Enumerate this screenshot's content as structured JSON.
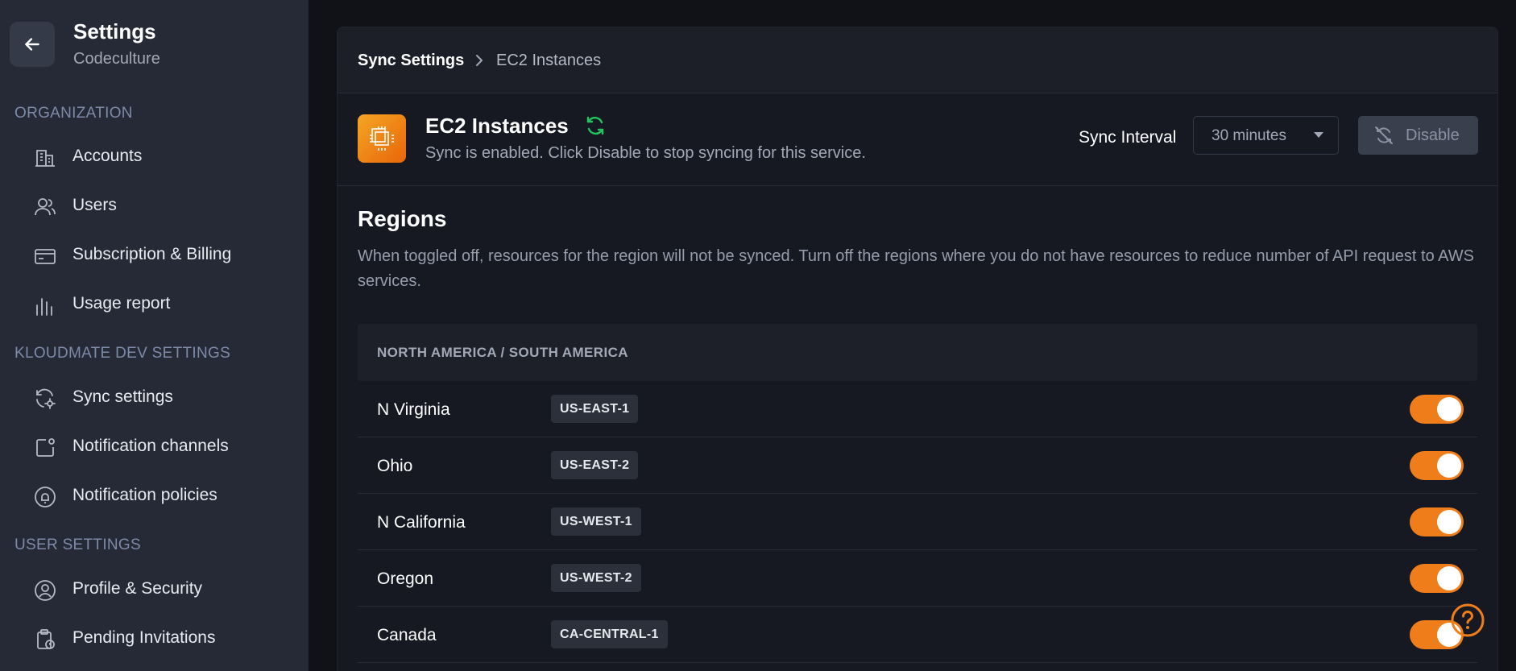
{
  "sidebar": {
    "title": "Settings",
    "subtitle": "Codeculture",
    "sections": [
      {
        "label": "ORGANIZATION"
      },
      {
        "label": "KLOUDMATE DEV SETTINGS"
      },
      {
        "label": "USER SETTINGS"
      }
    ],
    "items": [
      {
        "label": "Accounts",
        "icon": "building-icon"
      },
      {
        "label": "Users",
        "icon": "users-icon"
      },
      {
        "label": "Subscription & Billing",
        "icon": "credit-card-icon"
      },
      {
        "label": "Usage report",
        "icon": "bar-chart-icon"
      },
      {
        "label": "Sync settings",
        "icon": "sync-settings-icon"
      },
      {
        "label": "Notification channels",
        "icon": "notification-channel-icon"
      },
      {
        "label": "Notification policies",
        "icon": "bell-shield-icon"
      },
      {
        "label": "Profile & Security",
        "icon": "user-circle-icon"
      },
      {
        "label": "Pending Invitations",
        "icon": "clipboard-clock-icon"
      }
    ]
  },
  "breadcrumb": {
    "parent": "Sync Settings",
    "current": "EC2 Instances"
  },
  "service": {
    "title": "EC2 Instances",
    "description": "Sync is enabled. Click Disable to stop syncing for this service.",
    "sync_interval_label": "Sync Interval",
    "sync_interval_value": "30 minutes",
    "disable_label": "Disable"
  },
  "regions": {
    "title": "Regions",
    "description": "When toggled off, resources for the region will not be synced. Turn off the regions where you do not have resources to reduce number of API request to AWS services.",
    "group_label": "NORTH AMERICA / SOUTH AMERICA",
    "rows": [
      {
        "name": "N Virginia",
        "code": "US-EAST-1",
        "enabled": true
      },
      {
        "name": "Ohio",
        "code": "US-EAST-2",
        "enabled": true
      },
      {
        "name": "N California",
        "code": "US-WEST-1",
        "enabled": true
      },
      {
        "name": "Oregon",
        "code": "US-WEST-2",
        "enabled": true
      },
      {
        "name": "Canada",
        "code": "CA-CENTRAL-1",
        "enabled": true
      }
    ]
  },
  "colors": {
    "accent": "#ef7d1a",
    "sidebar_bg": "#262a36",
    "page_bg": "#101218",
    "sync_green": "#22c55e"
  }
}
